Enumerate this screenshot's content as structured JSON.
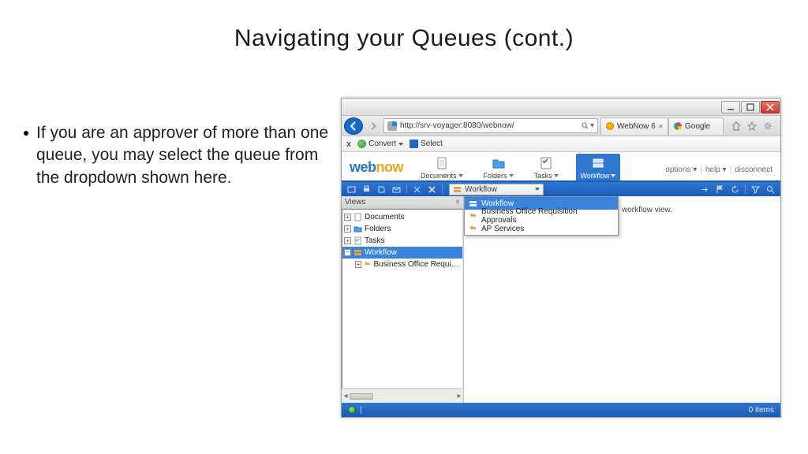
{
  "slide": {
    "title": "Navigating your Queues (cont.)",
    "bullet": "If you are an approver of more than one queue, you may select the queue from the dropdown shown here."
  },
  "browser": {
    "url": "http://srv-voyager:8080/webnow/",
    "search_hint": "",
    "tabs": [
      {
        "label": "WebNow 6"
      },
      {
        "label": "Google"
      }
    ]
  },
  "toolbar": {
    "close_x": "x",
    "convert": "Convert",
    "select": "Select"
  },
  "app": {
    "logo_a": "web",
    "logo_b": "now",
    "nav": [
      {
        "label": "Documents"
      },
      {
        "label": "Folders"
      },
      {
        "label": "Tasks"
      },
      {
        "label": "Workflow"
      }
    ],
    "links": {
      "options": "options",
      "help": "help",
      "disconnect": "disconnect"
    }
  },
  "workflow_dd": {
    "selected": "Workflow"
  },
  "views": {
    "title": "Views",
    "nodes": {
      "documents": "Documents",
      "folders": "Folders",
      "tasks": "Tasks",
      "workflow": "Workflow",
      "bora": "Business Office Requisition A"
    }
  },
  "dropdown": {
    "items": [
      "Workflow",
      "Business Office Requisition Approvals",
      "AP Services"
    ]
  },
  "main": {
    "hint": "workflow view."
  },
  "status": {
    "right": "0 items"
  }
}
